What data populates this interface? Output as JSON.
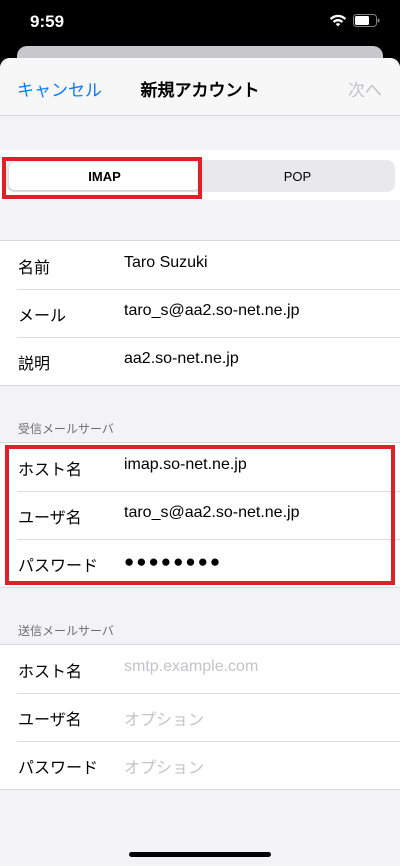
{
  "status": {
    "time": "9:59"
  },
  "nav": {
    "cancel": "キャンセル",
    "title": "新規アカウント",
    "next": "次へ"
  },
  "segment": {
    "options": [
      "IMAP",
      "POP"
    ],
    "selected": "IMAP"
  },
  "account": {
    "rows": [
      {
        "label": "名前",
        "value": "Taro Suzuki"
      },
      {
        "label": "メール",
        "value": "taro_s@aa2.so-net.ne.jp"
      },
      {
        "label": "説明",
        "value": "aa2.so-net.ne.jp"
      }
    ]
  },
  "incoming": {
    "header": "受信メールサーバ",
    "rows": [
      {
        "label": "ホスト名",
        "value": "imap.so-net.ne.jp"
      },
      {
        "label": "ユーザ名",
        "value": "taro_s@aa2.so-net.ne.jp"
      },
      {
        "label": "パスワード",
        "value": "●●●●●●●●"
      }
    ]
  },
  "outgoing": {
    "header": "送信メールサーバ",
    "rows": [
      {
        "label": "ホスト名",
        "placeholder": "smtp.example.com"
      },
      {
        "label": "ユーザ名",
        "placeholder": "オプション"
      },
      {
        "label": "パスワード",
        "placeholder": "オプション"
      }
    ]
  },
  "colors": {
    "accent": "#0a7aff",
    "highlight": "#e41e26",
    "disabled": "#c3c3c7"
  }
}
